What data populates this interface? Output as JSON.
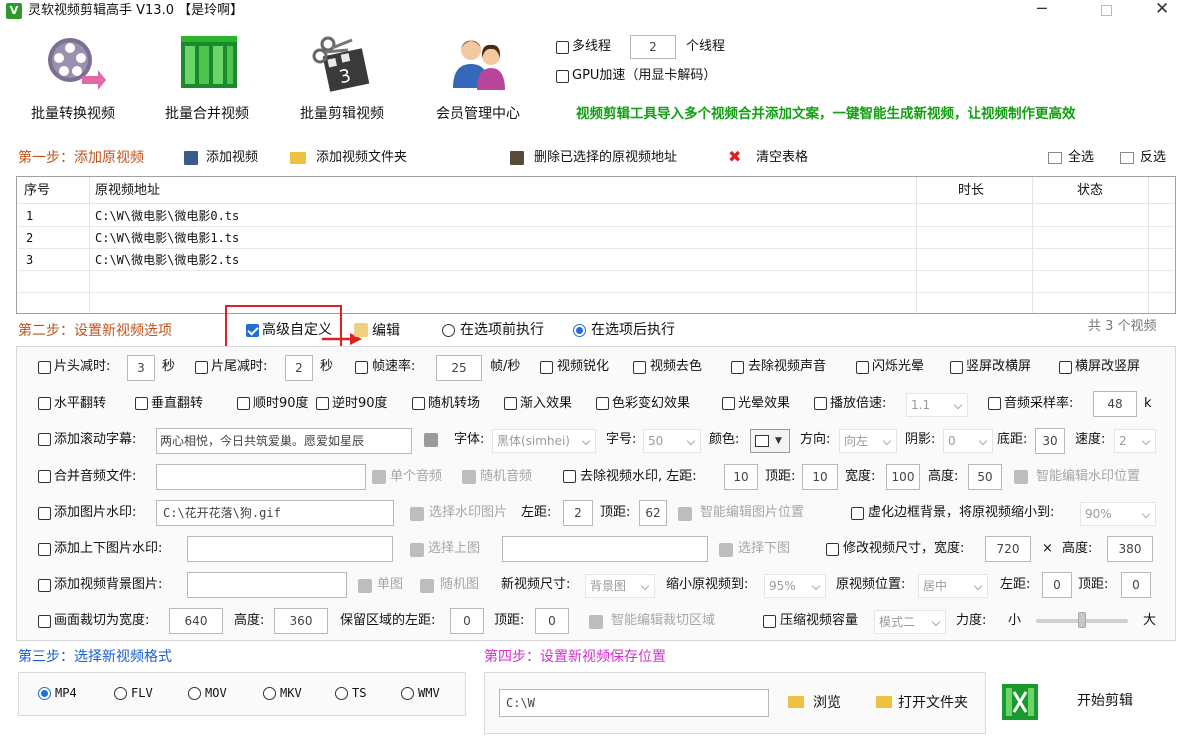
{
  "window": {
    "title": "灵软视频剪辑高手 V13.0 【是玲啊】",
    "controls": [
      "minimize-icon",
      "maximize-icon",
      "close-icon"
    ]
  },
  "toolbar": {
    "buttons": [
      {
        "label": "批量转换视频",
        "icon": "film-reel-convert-icon"
      },
      {
        "label": "批量合并视频",
        "icon": "film-strip-merge-icon"
      },
      {
        "label": "批量剪辑视频",
        "icon": "clapper-scissors-icon"
      },
      {
        "label": "会员管理中心",
        "icon": "users-icon"
      }
    ],
    "multithread_label": "多线程",
    "thread_count": "2",
    "thread_suffix": "个线程",
    "gpu_label": "GPU加速（用显卡解码）",
    "slogan": "视频剪辑工具导入多个视频合并添加文案，一键智能生成新视频，让视频制作更高效"
  },
  "step1": {
    "title": "第一步：添加原视频",
    "add_video": "添加视频",
    "add_folder": "添加视频文件夹",
    "delete_selected": "删除已选择的原视频地址",
    "clear_table": "清空表格",
    "select_all": "全选",
    "invert": "反选",
    "columns": [
      "序号",
      "原视频地址",
      "时长",
      "状态"
    ],
    "rows": [
      {
        "index": "1",
        "path": "C:\\W\\微电影\\微电影0.ts",
        "duration": "",
        "status": ""
      },
      {
        "index": "2",
        "path": "C:\\W\\微电影\\微电影1.ts",
        "duration": "",
        "status": ""
      },
      {
        "index": "3",
        "path": "C:\\W\\微电影\\微电影2.ts",
        "duration": "",
        "status": ""
      }
    ]
  },
  "step2": {
    "title": "第二步：设置新视频选项",
    "advanced_custom": "高级自定义",
    "edit": "编辑",
    "before_exec": "在选项前执行",
    "after_exec": "在选项后执行",
    "count_text": "共 3 个视频",
    "row1": {
      "head_cut": "片头减时:",
      "head_val": "3",
      "sec1": "秒",
      "tail_cut": "片尾减时:",
      "tail_val": "2",
      "sec2": "秒",
      "fps": "帧速率:",
      "fps_val": "25",
      "fps_unit": "帧/秒",
      "sharpen": "视频锐化",
      "decolor": "视频去色",
      "mute": "去除视频声音",
      "flash": "闪烁光晕",
      "v2h": "竖屏改横屏",
      "h2v": "横屏改竖屏"
    },
    "row2": {
      "hflip": "水平翻转",
      "vflip": "垂直翻转",
      "cw90": "顺时90度",
      "ccw90": "逆时90度",
      "random_trans": "随机转场",
      "fade_in": "渐入效果",
      "color_fx": "色彩变幻效果",
      "halo": "光晕效果",
      "speed": "播放倍速:",
      "speed_val": "1.1",
      "sample_rate": "音频采样率:",
      "sample_val": "48",
      "sample_unit": "k"
    },
    "row3": {
      "scroll_sub": "添加滚动字幕:",
      "scroll_text": "两心相悦，今日共筑爱巢。愿爱如星辰",
      "font": "字体:",
      "font_val": "黑体(simhei)",
      "size": "字号:",
      "size_val": "50",
      "color": "颜色:",
      "direction": "方向:",
      "direction_val": "向左",
      "shadow": "阴影:",
      "shadow_val": "0",
      "bottom": "底距:",
      "bottom_val": "30",
      "speed": "速度:",
      "speed_val": "2"
    },
    "row4": {
      "merge_audio": "合并音频文件:",
      "single_audio": "单个音频",
      "random_audio": "随机音频",
      "remove_wm": "去除视频水印, 左距:",
      "left_val": "10",
      "top": "顶距:",
      "top_val": "10",
      "width": "宽度:",
      "width_val": "100",
      "height": "高度:",
      "height_val": "50",
      "smart_wm": "智能编辑水印位置"
    },
    "row5": {
      "img_wm": "添加图片水印:",
      "img_path": "C:\\花开花落\\狗.gif",
      "choose_wm": "选择水印图片",
      "left": "左距:",
      "left_val": "2",
      "top": "顶距:",
      "top_val": "62",
      "smart_img": "智能编辑图片位置",
      "blur_bg": "虚化边框背景，将原视频缩小到:",
      "blur_val": "90%"
    },
    "row6": {
      "updown_wm": "添加上下图片水印:",
      "choose_up": "选择上图",
      "choose_down": "选择下图",
      "resize": "修改视频尺寸，宽度:",
      "width_val": "720",
      "times": "×",
      "height": "高度:",
      "height_val": "380"
    },
    "row7": {
      "bg_img": "添加视频背景图片:",
      "single_img": "单图",
      "random_img": "随机图",
      "new_size": "新视频尺寸:",
      "new_size_val": "背景图",
      "shrink": "缩小原视频到:",
      "shrink_val": "95%",
      "pos": "原视频位置:",
      "pos_val": "居中",
      "left": "左距:",
      "left_val": "0",
      "top": "顶距:",
      "top_val": "0"
    },
    "row8": {
      "crop": "画面裁切为宽度:",
      "crop_w": "640",
      "height": "高度:",
      "crop_h": "360",
      "keep_left": "保留区域的左距:",
      "keep_left_val": "0",
      "top": "顶距:",
      "top_val": "0",
      "smart_crop": "智能编辑裁切区域",
      "compress": "压缩视频容量",
      "mode_val": "模式二",
      "strength": "力度:",
      "small": "小",
      "big": "大",
      "strength_level": 0.5
    }
  },
  "step3": {
    "title": "第三步：选择新视频格式",
    "formats": [
      "MP4",
      "FLV",
      "MOV",
      "MKV",
      "TS",
      "WMV"
    ],
    "selected": "MP4"
  },
  "step4": {
    "title": "第四步：设置新视频保存位置",
    "path": "C:\\W",
    "browse": "浏览",
    "open_folder": "打开文件夹",
    "start": "开始剪辑"
  },
  "colors": {
    "accent": "#1e6fd9",
    "highlight_red": "#e02020",
    "slogan_green": "#12a012",
    "step_orange": "#c0541f"
  }
}
